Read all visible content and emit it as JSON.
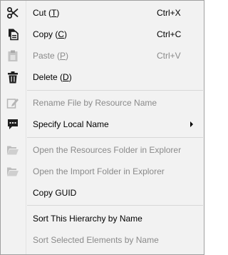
{
  "menu": {
    "cut": {
      "label": "Cut (",
      "key": "T",
      "end": ")",
      "shortcut": "Ctrl+X",
      "icon": "scissors-icon"
    },
    "copy": {
      "label": "Copy (",
      "key": "C",
      "end": ")",
      "shortcut": "Ctrl+C",
      "icon": "copy-icon"
    },
    "paste": {
      "label": "Paste (",
      "key": "P",
      "end": ")",
      "shortcut": "Ctrl+V",
      "icon": "clipboard-icon",
      "disabled": true
    },
    "delete": {
      "label": "Delete (",
      "key": "D",
      "end": ")",
      "icon": "trash-icon"
    },
    "rename": {
      "label": "Rename File by Resource Name",
      "icon": "rename-icon",
      "disabled": true
    },
    "specify_local_name": {
      "label": "Specify Local Name",
      "icon": "speech-bubble-icon",
      "submenu": true
    },
    "open_resources_folder": {
      "label": "Open the Resources Folder in Explorer",
      "icon": "folder-open-icon",
      "disabled": true
    },
    "open_import_folder": {
      "label": "Open the Import Folder in Explorer",
      "icon": "folder-open-icon",
      "disabled": true
    },
    "copy_guid": {
      "label": "Copy GUID"
    },
    "sort_hierarchy": {
      "label": "Sort This Hierarchy by Name"
    },
    "sort_selected": {
      "label": "Sort Selected Elements by Name",
      "disabled": true
    }
  },
  "colors": {
    "background": "#f2f2f2",
    "border": "#a0a0a0",
    "separator": "#d7d7d7",
    "disabled_text": "#8a8a8a",
    "icon": "#1e1e1e",
    "icon_disabled": "#b5b5b5"
  }
}
